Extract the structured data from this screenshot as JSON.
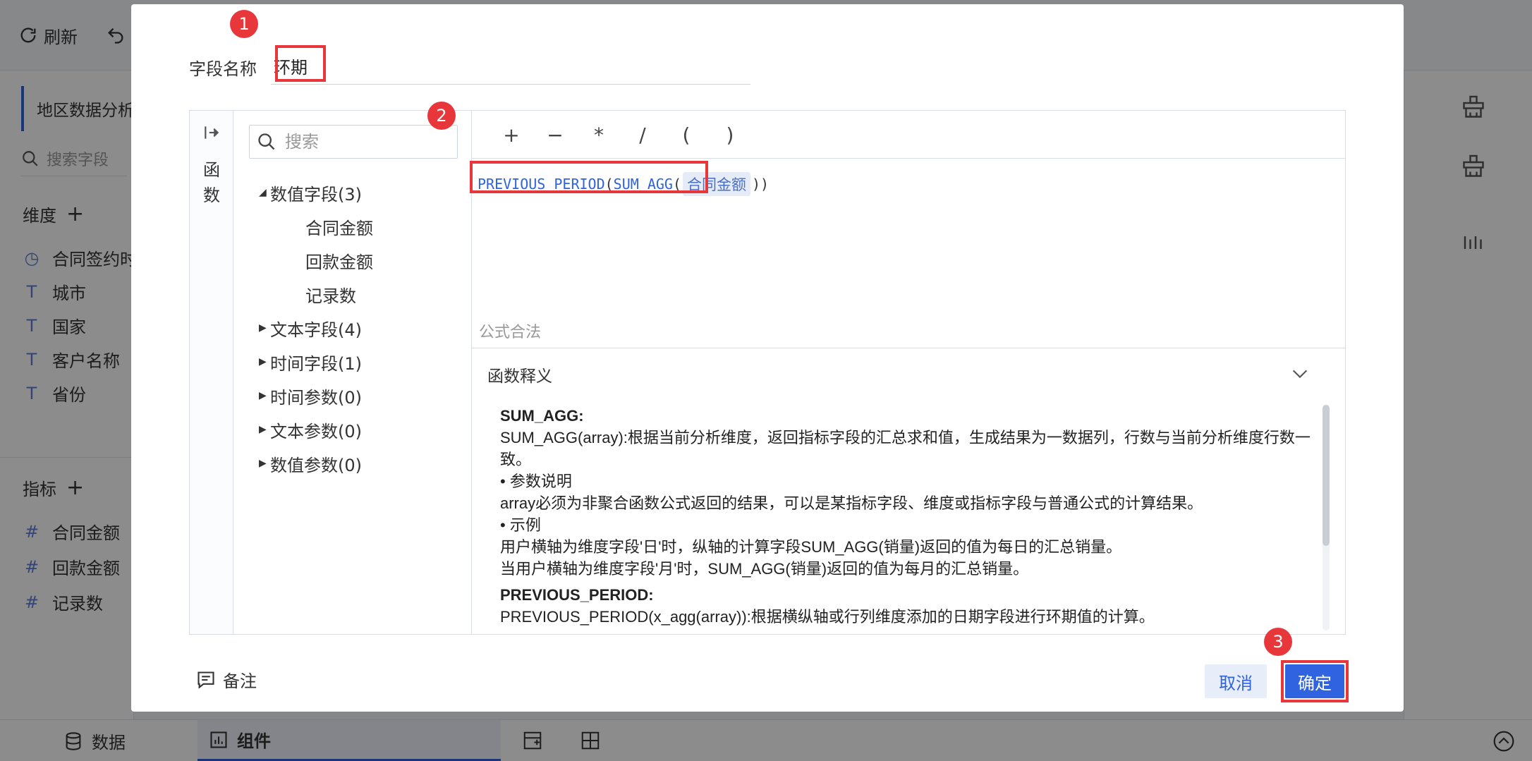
{
  "toolbar": {
    "refresh_label": "刷新"
  },
  "left_panel": {
    "title": "地区数据分析",
    "search_placeholder": "搜索字段",
    "dimension_label": "维度",
    "dimensions": [
      "合同签约时",
      "城市",
      "国家",
      "客户名称",
      "省份"
    ],
    "measure_label": "指标",
    "measures": [
      "合同金额",
      "回款金额",
      "记录数"
    ]
  },
  "bottom_bar": {
    "data_tab": "数据",
    "component_tab": "组件"
  },
  "dialog": {
    "name_label": "字段名称",
    "name_value": "环期",
    "rail_text": "函数",
    "search_placeholder": "搜索",
    "tree": [
      {
        "label": "数值字段(3)",
        "expanded": true,
        "children": [
          "合同金额",
          "回款金额",
          "记录数"
        ]
      },
      {
        "label": "文本字段(4)",
        "expanded": false
      },
      {
        "label": "时间字段(1)",
        "expanded": false
      },
      {
        "label": "时间参数(0)",
        "expanded": false
      },
      {
        "label": "文本参数(0)",
        "expanded": false
      },
      {
        "label": "数值参数(0)",
        "expanded": false
      }
    ],
    "operators": [
      "+",
      "−",
      "*",
      "/",
      "(",
      ")"
    ],
    "formula": {
      "fn_outer": "PREVIOUS_PERIOD",
      "fn_inner": "SUM_AGG",
      "field": "合同金额"
    },
    "valid_text": "公式合法",
    "doc": {
      "header": "函数释义",
      "sum_agg_title": "SUM_AGG:",
      "sum_agg_desc": "SUM_AGG(array):根据当前分析维度，返回指标字段的汇总求和值，生成结果为一数据列，行数与当前分析维度行数一致。",
      "param_title": "• 参数说明",
      "param_desc": "array必须为非聚合函数公式返回的结果，可以是某指标字段、维度或指标字段与普通公式的计算结果。",
      "example_title": "• 示例",
      "example_1": "用户横轴为维度字段'日'时，纵轴的计算字段SUM_AGG(销量)返回的值为每日的汇总销量。",
      "example_2": "当用户横轴为维度字段'月'时，SUM_AGG(销量)返回的值为每月的汇总销量。",
      "prev_title": "PREVIOUS_PERIOD:",
      "prev_desc": "PREVIOUS_PERIOD(x_agg(array)):根据横纵轴或行列维度添加的日期字段进行环期值的计算。"
    },
    "note_label": "备注",
    "cancel_label": "取消",
    "ok_label": "确定",
    "badges": [
      "1",
      "2",
      "3"
    ]
  },
  "colors": {
    "accent": "#2f63e0",
    "highlight": "#e8373a"
  }
}
